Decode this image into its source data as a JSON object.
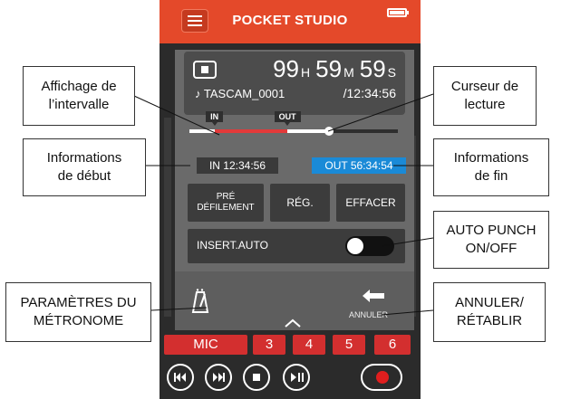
{
  "header": {
    "app_title": "POCKET STUDIO"
  },
  "time": {
    "hours": "99",
    "hours_unit": "H",
    "minutes": "59",
    "minutes_unit": "M",
    "seconds": "59",
    "seconds_unit": "S",
    "filename": "♪ TASCAM_0001",
    "total": "/12:34:56"
  },
  "markers": {
    "in_label": "IN",
    "out_label": "OUT"
  },
  "playback": {
    "in_fraction": 0.12,
    "out_fraction": 0.47,
    "position_fraction": 0.67
  },
  "info": {
    "in": "IN 12:34:56",
    "out": "OUT 56:34:54"
  },
  "buttons": {
    "pre_line1": "PRÉ",
    "pre_line2": "DÉFILEMENT",
    "reg": "RÉG.",
    "effacer": "EFFACER"
  },
  "auto_insert": {
    "label": "INSERT.AUTO",
    "state": "off"
  },
  "undo": {
    "label": "ANNULER"
  },
  "tracks": [
    "MIC",
    "3",
    "4",
    "5",
    "6"
  ],
  "colors": {
    "header": "#e4492a",
    "out_info": "#1a8ad7",
    "range": "#e33a3a",
    "record": "#e01e1e"
  },
  "icons": [
    "menu-icon",
    "battery-icon",
    "stop-icon",
    "metronome-icon",
    "undo-icon",
    "chevron-up-icon",
    "rewind-icon",
    "forward-icon",
    "stop-transport-icon",
    "play-pause-icon",
    "record-icon"
  ],
  "callouts": {
    "range_display": {
      "line1": "Affichage de",
      "line2": "l’intervalle"
    },
    "playhead": {
      "line1": "Curseur de",
      "line2": "lecture"
    },
    "start_info": {
      "line1": "Informations",
      "line2": "de début"
    },
    "end_info": {
      "line1": "Informations",
      "line2": "de fin"
    },
    "auto_punch": {
      "line1": "AUTO PUNCH",
      "line2": "ON/OFF"
    },
    "metronome": {
      "line1": "PARAMÈTRES DU",
      "line2": "MÉTRONOME"
    },
    "undo_redo": {
      "line1": "ANNULER/",
      "line2": "RÉTABLIR"
    }
  }
}
